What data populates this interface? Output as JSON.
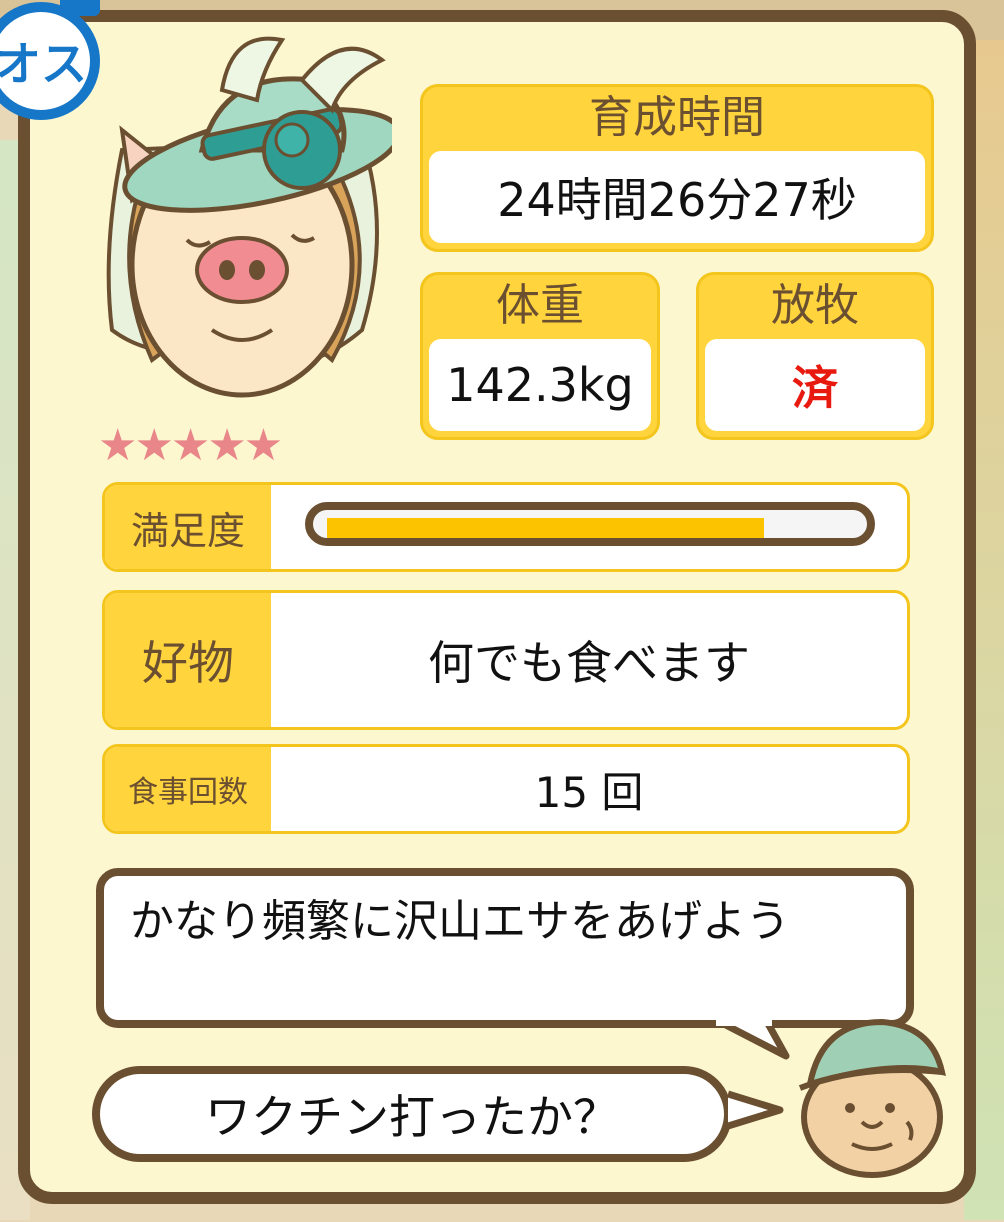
{
  "gender_badge": "オス",
  "pet": {
    "rarity_stars": 5,
    "stars_text": "★★★★★"
  },
  "stats": {
    "raising_time": {
      "label": "育成時間",
      "value": "24時間26分27秒"
    },
    "weight": {
      "label": "体重",
      "value": "142.3kg"
    },
    "grazing": {
      "label": "放牧",
      "value": "済",
      "value_color": "#e8190f"
    }
  },
  "satisfaction": {
    "label": "満足度",
    "level": 0.83
  },
  "favorite_food": {
    "label": "好物",
    "value": "何でも食べます"
  },
  "meal_count": {
    "label": "食事回数",
    "value": "15 回"
  },
  "advice": {
    "message": "かなり頻繁に沢山エサをあげよう",
    "question": "ワクチン打ったか？"
  },
  "colors": {
    "frame": "#6b4f31",
    "panel": "#fdf7cf",
    "accent": "#ffd43c",
    "meter": "#fcc400",
    "badge": "#1677c9",
    "stars": "#e8868a"
  }
}
